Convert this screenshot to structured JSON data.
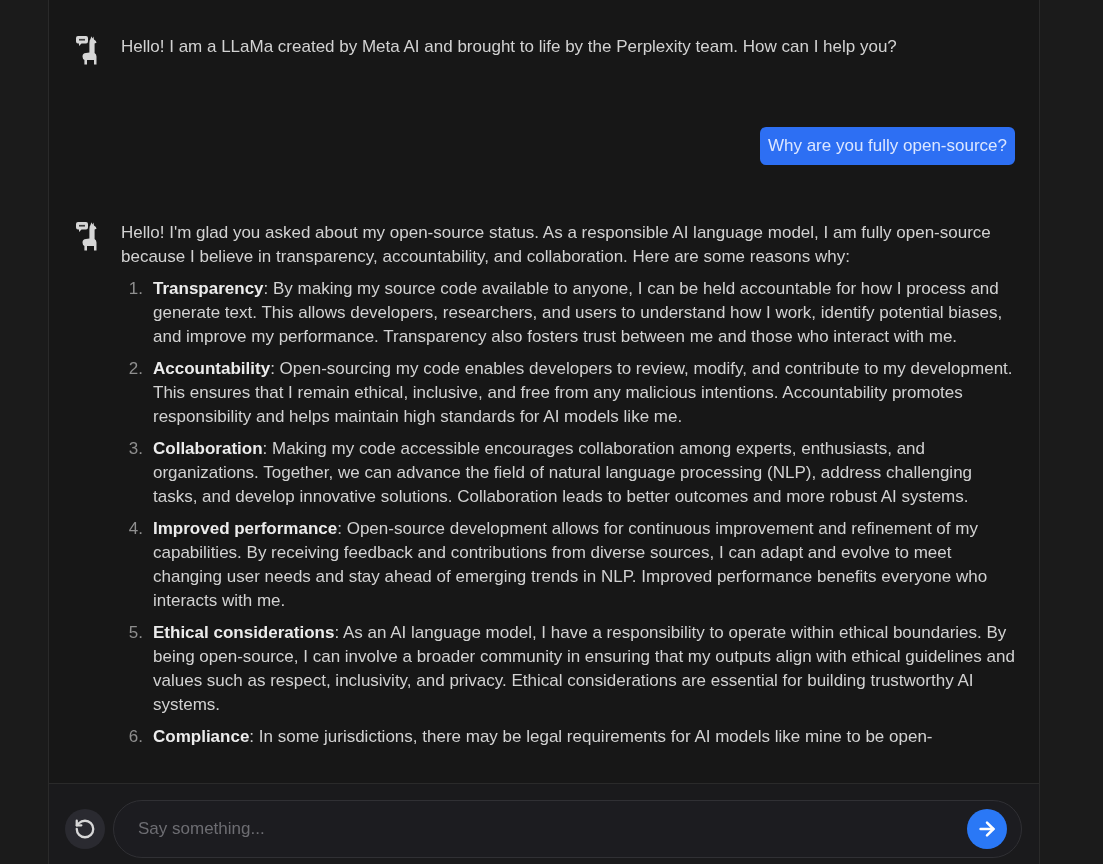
{
  "messages": [
    {
      "kind": "assistant",
      "text": "Hello! I am a LLaMa created by Meta AI and brought to life by the Perplexity team. How can I help you?"
    },
    {
      "kind": "user",
      "text": "Why are you fully open-source?"
    },
    {
      "kind": "assistant",
      "text": "Hello! I'm glad you asked about my open-source status. As a responsible AI language model, I am fully open-source because I believe in transparency, accountability, and collaboration. Here are some reasons why:",
      "list": [
        {
          "number": "1.",
          "text": "**Transparency**: By making my source code available to anyone, I can be held accountable for how I process and generate text. This allows developers, researchers, and users to understand how I work, identify potential biases, and improve my performance. Transparency also fosters trust between me and those who interact with me."
        },
        {
          "number": "2.",
          "text": "**Accountability**: Open-sourcing my code enables developers to review, modify, and contribute to my development. This ensures that I remain ethical, inclusive, and free from any malicious intentions. Accountability promotes responsibility and helps maintain high standards for AI models like me."
        },
        {
          "number": "3.",
          "text": "**Collaboration**: Making my code accessible encourages collaboration among experts, enthusiasts, and organizations. Together, we can advance the field of natural language processing (NLP), address challenging tasks, and develop innovative solutions. Collaboration leads to better outcomes and more robust AI systems."
        },
        {
          "number": "4.",
          "text": "**Improved performance**: Open-source development allows for continuous improvement and refinement of my capabilities. By receiving feedback and contributions from diverse sources, I can adapt and evolve to meet changing user needs and stay ahead of emerging trends in NLP. Improved performance benefits everyone who interacts with me."
        },
        {
          "number": "5.",
          "text": "**Ethical considerations**: As an AI language model, I have a responsibility to operate within ethical boundaries. By being open-source, I can involve a broader community in ensuring that my outputs align with ethical guidelines and values such as respect, inclusivity, and privacy. Ethical considerations are essential for building trustworthy AI systems."
        },
        {
          "number": "6.",
          "text": "**Compliance**: In some jurisdictions, there may be legal requirements for AI models like mine to be open-"
        }
      ]
    }
  ],
  "composer": {
    "placeholder": "Say something..."
  }
}
